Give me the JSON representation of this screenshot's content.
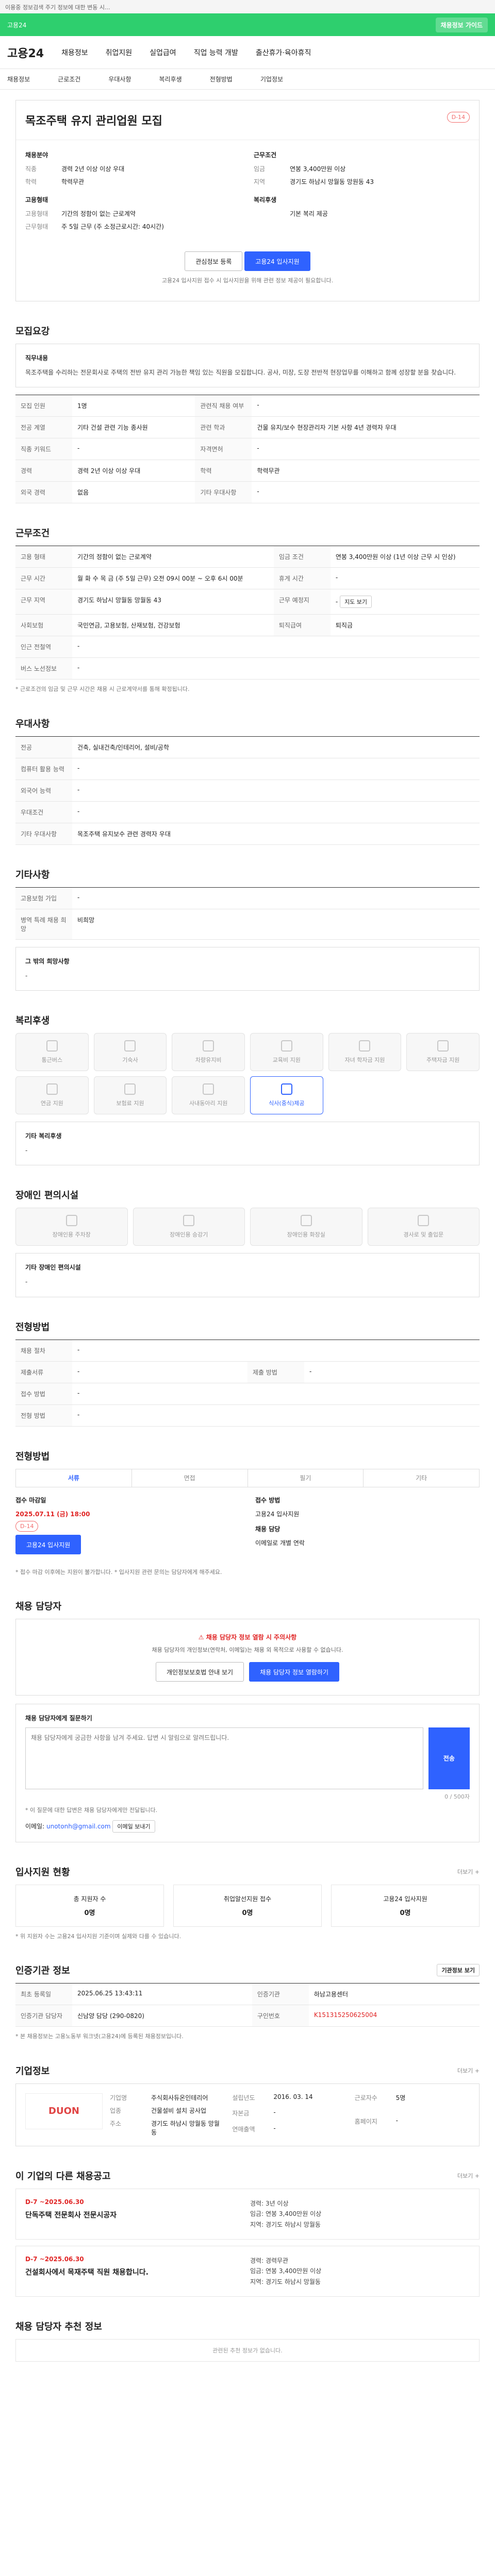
{
  "topbar": {
    "text": "이용중 정보검색 주기 정보에 대한 변동 시..."
  },
  "banner": {
    "left": "고용24",
    "right": "채용정보 가이드"
  },
  "gnb": {
    "logo": "고용24",
    "items": [
      "채용정보",
      "취업지원",
      "실업급여",
      "직업 능력 개발",
      "출산휴가·육아휴직"
    ]
  },
  "subnav": {
    "items": [
      "채용정보",
      "근로조건",
      "우대사항",
      "복리후생",
      "전형방법",
      "기업정보"
    ]
  },
  "hero": {
    "title": "목조주택 유지 관리업원 모집",
    "dday": "D-14",
    "left_section": "채용분야",
    "left_kv": [
      {
        "k": "직종",
        "v": "경력 2년 이상 이상 우대"
      },
      {
        "k": "학력",
        "v": "학력무관"
      }
    ],
    "right_section": "근무조건",
    "right_kv": [
      {
        "k": "임금",
        "v": "연봉 3,400만원 이상"
      },
      {
        "k": "지역",
        "v": "경기도 하남시 망월동 망원동 43"
      }
    ],
    "left2_section": "고용형태",
    "left2_kv": [
      {
        "k": "고용형태",
        "v": "기간의 정함이 없는 근로계약"
      },
      {
        "k": "근무형태",
        "v": "주 5일 근무 (주 소정근로시간: 40시간)"
      }
    ],
    "right2_section": "복리후생",
    "right2_kv": [
      {
        "k": "",
        "v": "기본 복리 제공"
      }
    ],
    "btn_save": "관심정보 등록",
    "btn_apply": "고용24 입사지원",
    "note": "고용24 입사지원 접수 시 입사지원을 위해 관련 정보 제공이 필요합니다."
  },
  "recruit": {
    "title": "모집요강",
    "field_title": "직무내용",
    "field_desc": "목조주택을 수리하는 전문회사로 주택의 전반 유지 관리 가능한 책임 있는 직원을 모집합니다. 공사, 미장, 도장 전반적 현장업무를 이해하고 함께 성장할 분을 찾습니다.",
    "rows": [
      {
        "k1": "모집 인원",
        "v1": "1명",
        "k2": "관련직 채용 여부",
        "v2": "-"
      },
      {
        "k1": "전공 계열",
        "v1": "기타 건설 관련 기능 종사원",
        "k2": "관련 학과",
        "v2": "건물 유지/보수 현장관리자 기본 사항 4년 경력자 우대"
      },
      {
        "k1": "직종 키워드",
        "v1": "-",
        "k2": "자격면허",
        "v2": "-"
      },
      {
        "k1": "경력",
        "v1": "경력 2년 이상 이상 우대",
        "k2": "학력",
        "v2": "학력무관"
      },
      {
        "k1": "외국 경력",
        "v1": "없음",
        "k2": "기타 우대사항",
        "v2": "-"
      }
    ]
  },
  "conditions": {
    "title": "근무조건",
    "rows": [
      {
        "k1": "고용 형태",
        "v1": "기간의 정함이 없는 근로계약",
        "k2": "임금 조건",
        "v2": "연봉 3,400만원 이상 (1년 이상 근무 시 인상)"
      },
      {
        "k1": "근무 시간",
        "v1": "월 화 수 목 금 (주 5일 근무) 오전 09시 00분 ~ 오후 6시 00분",
        "k2": "휴게 시간",
        "v2": "-"
      },
      {
        "k1": "근무 지역",
        "v1": "경기도 하남시 망월동 망월동 43",
        "k2": "근무 예정지",
        "v2": "-"
      },
      {
        "k1": "사회보험",
        "v1": "국민연금, 고용보험, 산재보험, 건강보험",
        "k2": "퇴직급여",
        "v2": "퇴직금"
      },
      {
        "k1": "인근 전철역",
        "v1": "-",
        "k2": "",
        "v2": ""
      },
      {
        "k1": "버스 노선정보",
        "v1": "-",
        "k2": "",
        "v2": ""
      }
    ],
    "map_btn": "지도 보기",
    "note": "* 근로조건의 임금 및 근무 시간은 채용 시 근로계약서를 통해 확정됩니다."
  },
  "prefer": {
    "title": "우대사항",
    "rows": [
      {
        "k": "전공",
        "v": "건축, 실내건축/인테리어, 설비/공학"
      },
      {
        "k": "컴퓨터 활용 능력",
        "v": "-"
      },
      {
        "k": "외국어 능력",
        "v": "-"
      },
      {
        "k": "우대조건",
        "v": "-"
      },
      {
        "k": "기타 우대사항",
        "v": "목조주택 유지보수 관련 경력자 우대"
      }
    ]
  },
  "others": {
    "title": "기타사항",
    "rows": [
      {
        "k": "고용보험 가입",
        "v": "-"
      },
      {
        "k": "병역 특례 채용 희망",
        "v": "비희망"
      }
    ],
    "extra_title": "그 밖의 희망사항",
    "extra_value": "-"
  },
  "welfare": {
    "title": "복리후생",
    "items": [
      "통근버스",
      "기숙사",
      "차량유지비",
      "교육비 지원",
      "자녀 학자금 지원",
      "주택자금 지원",
      "연금 지원",
      "보험료 지원",
      "사내동아리 지원",
      "식사(중식)제공"
    ],
    "active": [
      9
    ],
    "extra_title": "기타 복리후생",
    "extra_value": "-"
  },
  "disability": {
    "title": "장애인 편의시설",
    "items": [
      "장애인용 주차장",
      "장애인용 승강기",
      "장애인용 화장실",
      "경사로 및 출입문"
    ],
    "extra_title": "기타 장애인 편의시설",
    "extra_value": "-"
  },
  "process": {
    "title": "전형방법",
    "rows": [
      {
        "k": "채용 절차",
        "v": "-"
      },
      {
        "k": "제출서류",
        "v": "-",
        "k2": "제출 방법",
        "v2": "-"
      },
      {
        "k": "접수 방법",
        "v": "-",
        "k2": "",
        "v2": ""
      },
      {
        "k": "전형 방법",
        "v": "-",
        "k2": "",
        "v2": ""
      }
    ]
  },
  "method": {
    "title": "전형방법",
    "tabs": [
      "서류",
      "면접",
      "필기",
      "기타"
    ],
    "active_tab": 0,
    "left_label": "접수 마감일",
    "left_value": "2025.07.11 (금) 18:00",
    "left_dday": "D-14",
    "right_label": "접수 방법",
    "right_value": "고용24 입사지원",
    "right_label2": "채용 담당",
    "right_value2": "이메일로 개별 연락",
    "apply_btn": "고용24 입사지원",
    "notes": "* 접수 마감 이후에는 지원이 불가합니다. * 입사지원 관련 문의는 담당자에게 해주세요."
  },
  "contact": {
    "title": "채용 담당자",
    "warn": "채용 담당자 정보 열람 시 주의사항",
    "desc": "채용 담당자의 개인정보(연락처, 이메일)는 채용 외 목적으로 사용할 수 없습니다.",
    "btn_view": "개인정보보호법 안내 보기",
    "btn_open": "채용 담당자 정보 열람하기",
    "inquiry_title": "채용 담당자에게 질문하기",
    "inquiry_placeholder": "채용 담당자에게 궁금한 사항을 남겨 주세요. 답변 시 알림으로 알려드립니다.",
    "count": "0 / 500자",
    "send_btn": "전송",
    "notes": "* 이 질문에 대한 답변은 채용 담당자에게만 전달됩니다.",
    "email_label": "이메일",
    "email_value": "unotonh@gmail.com",
    "email_btn": "이메일 보내기"
  },
  "stats": {
    "title": "입사지원 현황",
    "more": "더보기 +",
    "items": [
      {
        "label": "총 지원자 수",
        "value": "0명"
      },
      {
        "label": "취업알선지원 접수",
        "value": "0명"
      },
      {
        "label": "고용24 입사지원",
        "value": "0명"
      }
    ],
    "note": "* 위 지원자 수는 고용24 입사지원 기준이며 실제와 다를 수 있습니다."
  },
  "admin": {
    "title": "인증기관 정보",
    "btn": "기관정보 보기",
    "rows": [
      {
        "k1": "최초 등록일",
        "v1": "2025.06.25 13:43:11",
        "k2": "인증기관",
        "v2": "하남고용센터"
      },
      {
        "k1": "인증기관 담당자",
        "v1": "신남양 담당 (290-0820)",
        "k2": "구인번호",
        "v2": "K151315250625004"
      }
    ],
    "notes": "* 본 채용정보는 고용노동부 워크넷(고용24)에 등록된 채용정보입니다."
  },
  "company": {
    "title": "기업정보",
    "more": "더보기 +",
    "logo": "DUON",
    "kv1": [
      {
        "k": "기업명",
        "v": "주식회사듀온인테리어"
      },
      {
        "k": "업종",
        "v": "건물설비 설치 공사업"
      },
      {
        "k": "주소",
        "v": "경기도 하남시 망월동 망월동"
      }
    ],
    "kv2": [
      {
        "k": "설립년도",
        "v": "2016. 03. 14"
      },
      {
        "k": "자본금",
        "v": "-"
      },
      {
        "k": "연매출액",
        "v": "-"
      }
    ],
    "kv3": [
      {
        "k": "근로자수",
        "v": "5명"
      },
      {
        "k": "홈페이지",
        "v": "-"
      }
    ]
  },
  "other_jobs": {
    "title": "이 기업의 다른 채용공고",
    "more": "더보기 +",
    "items": [
      {
        "dday": "D-7 ~2025.06.30",
        "title": "단독주택 전문회사 전문시공자",
        "kv": [
          "경력: 3년 이상",
          "임금: 연봉 3,400만원 이상",
          "지역: 경기도 하남시 망월동"
        ]
      },
      {
        "dday": "D-7 ~2025.06.30",
        "title": "건설회사에서 목재주택 직원 채용합니다.",
        "kv": [
          "경력: 경력무관",
          "임금: 연봉 3,400만원 이상",
          "지역: 경기도 하남시 망월동"
        ]
      }
    ]
  },
  "recommend": {
    "title": "채용 담당자 추천 정보",
    "empty": "관련된 추천 정보가 없습니다."
  }
}
